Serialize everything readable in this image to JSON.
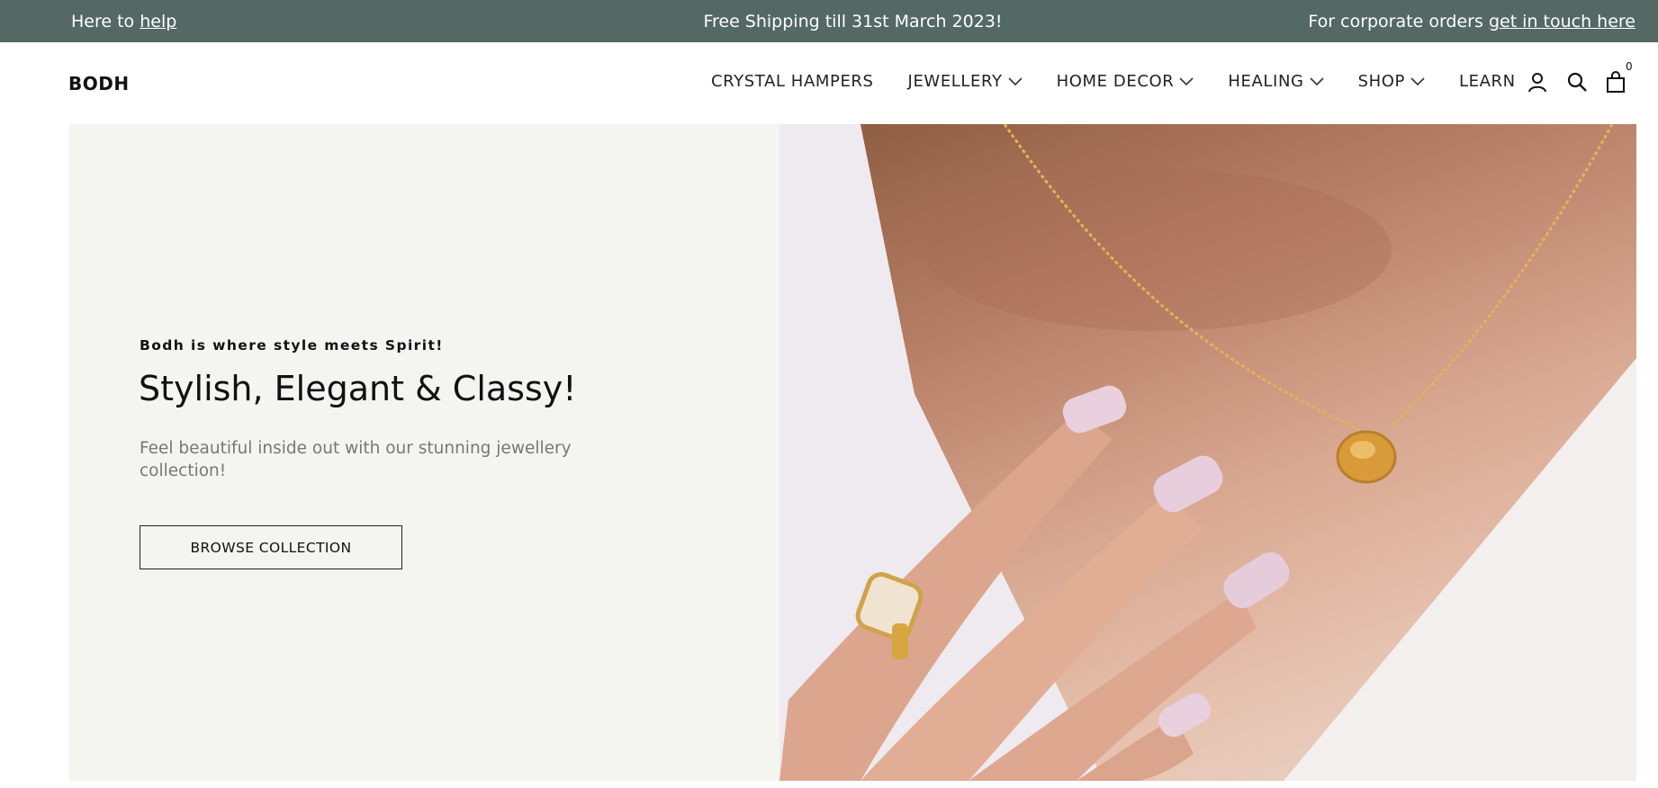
{
  "announcement": {
    "left_prefix": "Here to",
    "left_link": "help",
    "center": "Free Shipping till 31st March 2023!",
    "right_prefix": "For corporate orders",
    "right_link": "get in touch here",
    "bg_color": "#546864"
  },
  "header": {
    "logo": "BODH",
    "nav": [
      {
        "label": "CRYSTAL HAMPERS",
        "has_dropdown": false
      },
      {
        "label": "JEWELLERY",
        "has_dropdown": true
      },
      {
        "label": "HOME DECOR",
        "has_dropdown": true
      },
      {
        "label": "HEALING",
        "has_dropdown": true
      },
      {
        "label": "SHOP",
        "has_dropdown": true
      },
      {
        "label": "LEARN",
        "has_dropdown": false
      }
    ],
    "icons": [
      "account-icon",
      "search-icon",
      "cart-icon"
    ],
    "cart_count": "0"
  },
  "hero": {
    "eyebrow": "Bodh is where style meets Spirit!",
    "headline": "Stylish, Elegant & Classy!",
    "subtext": "Feel beautiful inside out with our stunning jewellery collection!",
    "cta_label": "BROWSE COLLECTION",
    "panel_color": "#f4f4f1"
  }
}
